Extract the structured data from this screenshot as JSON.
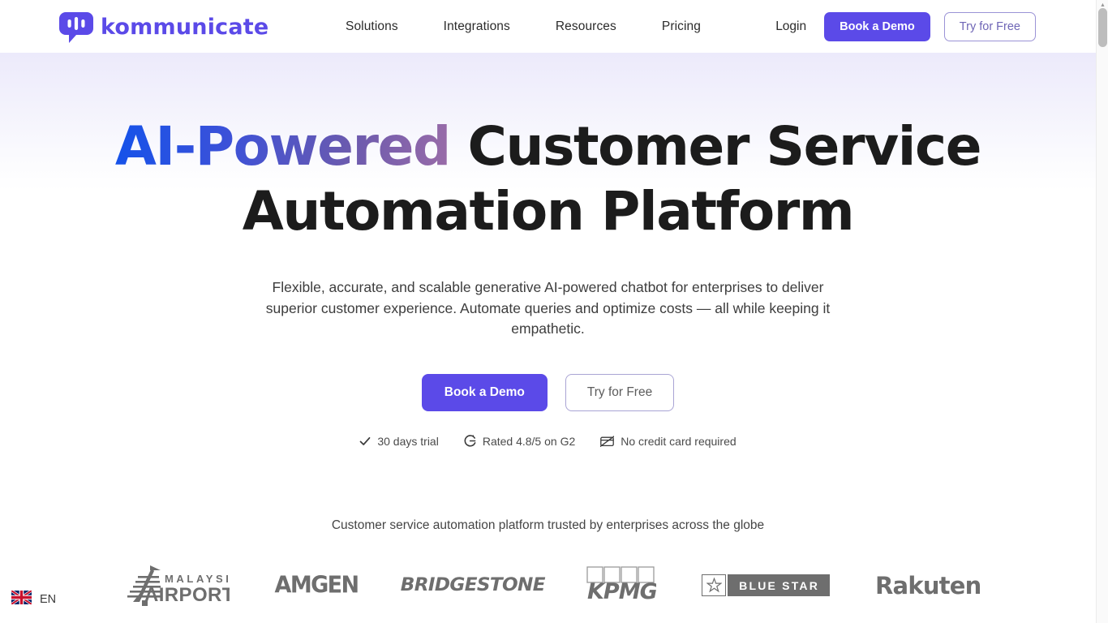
{
  "brand": {
    "name": "kommunicate",
    "icon": "chat-bubble-icon",
    "color": "#5b4ae8"
  },
  "nav": {
    "items": [
      {
        "label": "Solutions"
      },
      {
        "label": "Integrations"
      },
      {
        "label": "Resources"
      },
      {
        "label": "Pricing"
      }
    ],
    "login_label": "Login",
    "demo_label": "Book a Demo",
    "free_label": "Try for Free"
  },
  "hero": {
    "headline_highlight": "AI-Powered",
    "headline_rest": " Customer Service",
    "headline_line2": "Automation Platform",
    "subtitle": "Flexible, accurate, and scalable generative AI-powered chatbot for enterprises to deliver superior customer experience. Automate queries and optimize costs — all while keeping it empathetic.",
    "primary_cta": "Book a Demo",
    "secondary_cta": "Try for Free",
    "trust": [
      {
        "icon": "check-icon",
        "label": "30 days trial"
      },
      {
        "icon": "g2-icon",
        "label": "Rated 4.8/5 on G2"
      },
      {
        "icon": "no-credit-card-icon",
        "label": "No credit card required"
      }
    ]
  },
  "social_proof": {
    "caption": "Customer service automation platform trusted by enterprises across the globe",
    "logos": [
      {
        "name": "Malaysia Airports",
        "line1": "MALAYSIA",
        "line2": "AIRPORTS"
      },
      {
        "name": "Amgen",
        "word": "AMGEN"
      },
      {
        "name": "Bridgestone",
        "word": "BRIDGESTONE"
      },
      {
        "name": "KPMG",
        "word": "KPMG"
      },
      {
        "name": "Blue Star",
        "word": "BLUE STAR"
      },
      {
        "name": "Rakuten",
        "word": "Rakuten"
      }
    ]
  },
  "language": {
    "code": "EN",
    "flag": "uk-flag-icon"
  },
  "theme": {
    "accent": "#5b4ae8",
    "headline_dark": "#1c1c1c",
    "gradient_start": "#1452ea",
    "gradient_end": "#9a6ca8"
  }
}
